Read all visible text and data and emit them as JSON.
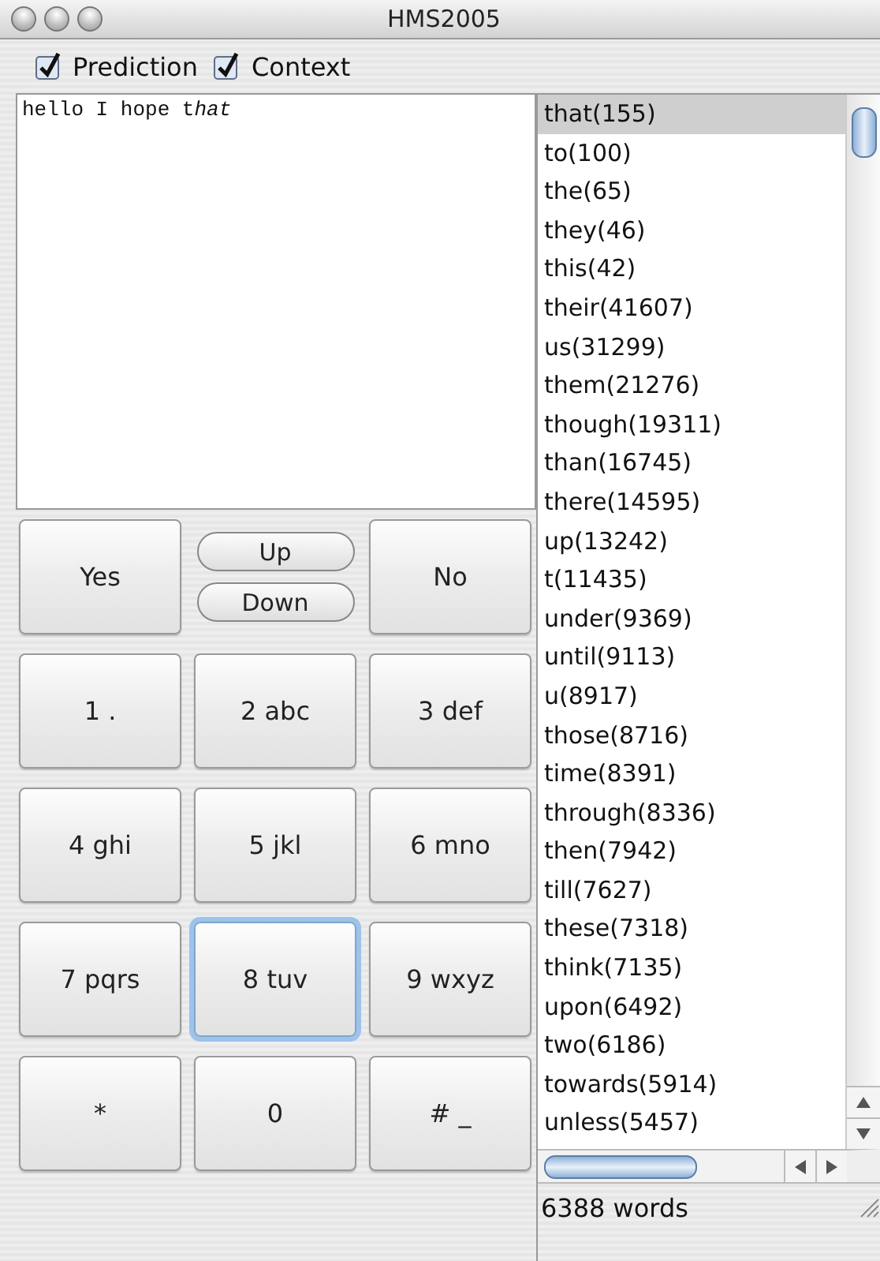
{
  "window": {
    "title": "HMS2005"
  },
  "options": [
    {
      "label": "Prediction",
      "checked": true
    },
    {
      "label": "Context",
      "checked": true
    }
  ],
  "text_area": {
    "typed": "hello I hope t",
    "completion": "hat"
  },
  "top_row": {
    "yes": "Yes",
    "up": "Up",
    "down": "Down",
    "no": "No"
  },
  "keypad": [
    {
      "kind": "key",
      "label": "1 .",
      "focused": false
    },
    {
      "kind": "key",
      "label": "2 abc",
      "focused": false
    },
    {
      "kind": "key",
      "label": "3 def",
      "focused": false
    },
    {
      "kind": "key",
      "label": "4 ghi",
      "focused": false
    },
    {
      "kind": "key",
      "label": "5 jkl",
      "focused": false
    },
    {
      "kind": "key",
      "label": "6 mno",
      "focused": false
    },
    {
      "kind": "key",
      "label": "7 pqrs",
      "focused": false
    },
    {
      "kind": "key",
      "label": "8 tuv",
      "focused": true
    },
    {
      "kind": "key",
      "label": "9 wxyz",
      "focused": false
    },
    {
      "kind": "key",
      "label": "*",
      "focused": false
    },
    {
      "kind": "key",
      "label": "0",
      "focused": false
    },
    {
      "kind": "key",
      "label": "# _",
      "focused": false
    }
  ],
  "suggestions": [
    {
      "label": "that(155)",
      "selected": true
    },
    {
      "label": "to(100)",
      "selected": false
    },
    {
      "label": "the(65)",
      "selected": false
    },
    {
      "label": "they(46)",
      "selected": false
    },
    {
      "label": "this(42)",
      "selected": false
    },
    {
      "label": "their(41607)",
      "selected": false
    },
    {
      "label": "us(31299)",
      "selected": false
    },
    {
      "label": "them(21276)",
      "selected": false
    },
    {
      "label": "though(19311)",
      "selected": false
    },
    {
      "label": "than(16745)",
      "selected": false
    },
    {
      "label": "there(14595)",
      "selected": false
    },
    {
      "label": "up(13242)",
      "selected": false
    },
    {
      "label": "t(11435)",
      "selected": false
    },
    {
      "label": "under(9369)",
      "selected": false
    },
    {
      "label": "until(9113)",
      "selected": false
    },
    {
      "label": "u(8917)",
      "selected": false
    },
    {
      "label": "those(8716)",
      "selected": false
    },
    {
      "label": "time(8391)",
      "selected": false
    },
    {
      "label": "through(8336)",
      "selected": false
    },
    {
      "label": "then(7942)",
      "selected": false
    },
    {
      "label": "till(7627)",
      "selected": false
    },
    {
      "label": "these(7318)",
      "selected": false
    },
    {
      "label": "think(7135)",
      "selected": false
    },
    {
      "label": "upon(6492)",
      "selected": false
    },
    {
      "label": "two(6186)",
      "selected": false
    },
    {
      "label": "towards(5914)",
      "selected": false
    },
    {
      "label": "unless(5457)",
      "selected": false
    }
  ],
  "status_bar": {
    "text": "6388 words"
  }
}
